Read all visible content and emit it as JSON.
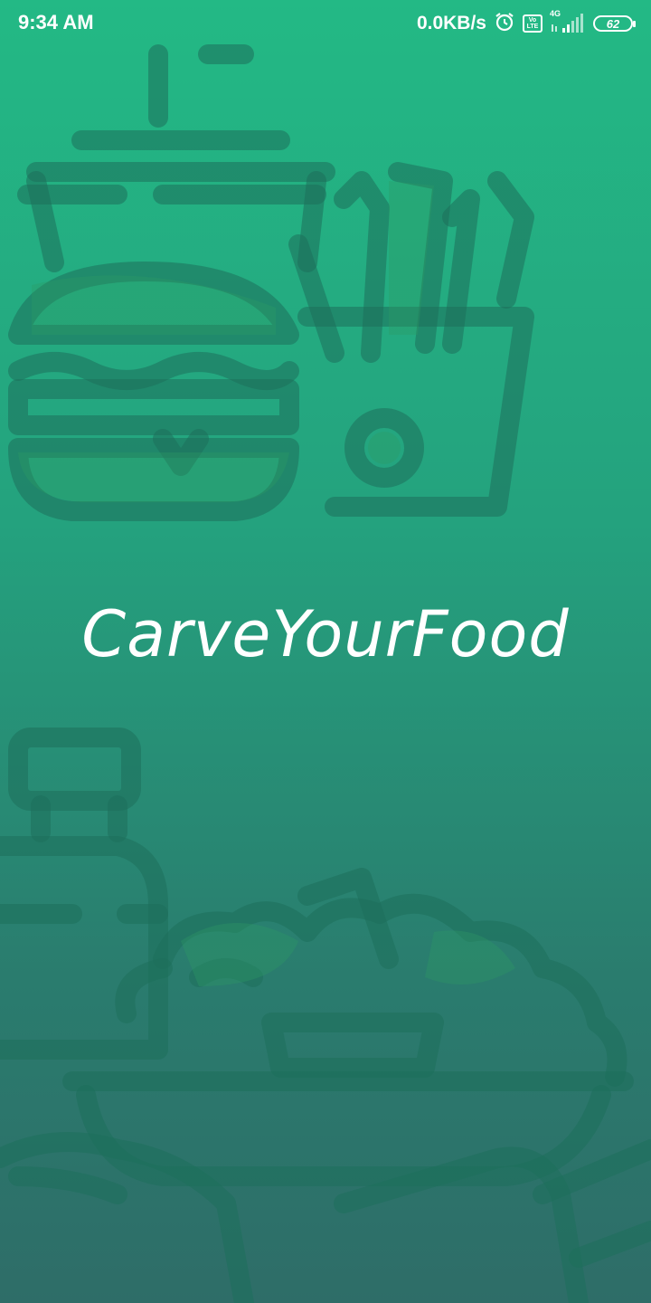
{
  "status_bar": {
    "time": "9:34 AM",
    "net_speed": "0.0KB/s",
    "volte_top": "Vo",
    "volte_bottom": "LTE",
    "network_type": "4G",
    "battery_level": "62",
    "icons": [
      "alarm-icon",
      "volte-icon",
      "signal-icon",
      "battery-icon"
    ]
  },
  "splash": {
    "app_name": "CarveYourFood",
    "background_top": "#23b985",
    "background_bottom": "#2e6d68",
    "illustrations": [
      "drink-cup-icon",
      "burger-icon",
      "fries-icon",
      "bottle-icon",
      "salad-bowl-icon",
      "sandwich-icon"
    ]
  }
}
